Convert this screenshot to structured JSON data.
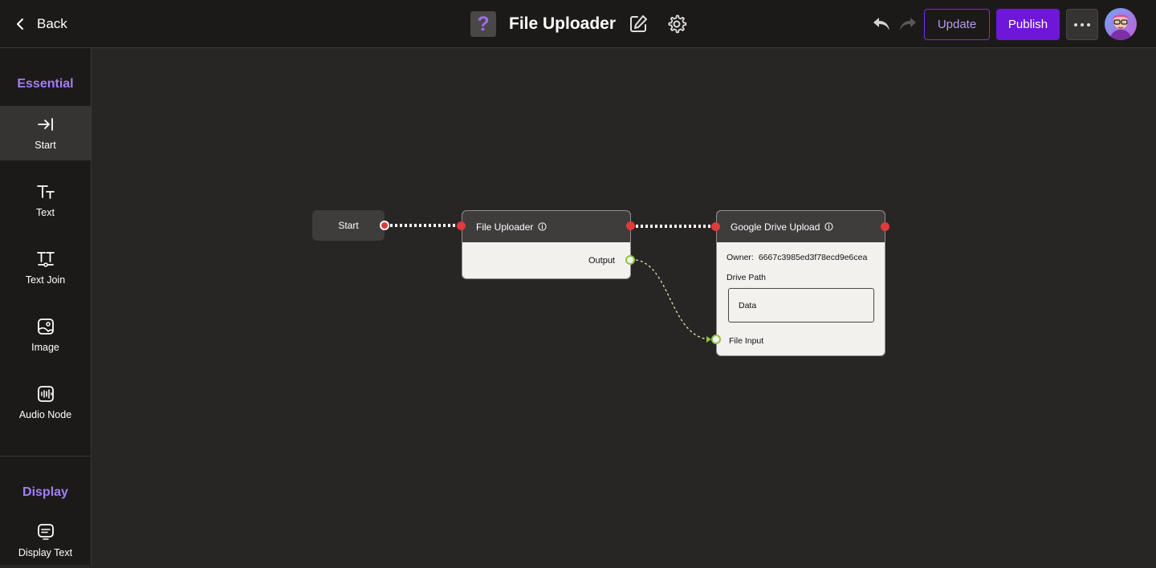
{
  "header": {
    "back_label": "Back",
    "app_icon_glyph": "?",
    "title": "File Uploader",
    "update_label": "Update",
    "publish_label": "Publish",
    "accent_color": "#6e17d9"
  },
  "sidebar": {
    "essential_label": "Essential",
    "display_label": "Display",
    "items": [
      {
        "label": "Start",
        "icon": "arrow-to-bar-icon",
        "active": true
      },
      {
        "label": "Text",
        "icon": "text-icon"
      },
      {
        "label": "Text Join",
        "icon": "text-join-icon"
      },
      {
        "label": "Image",
        "icon": "image-icon"
      },
      {
        "label": "Audio Node",
        "icon": "audio-icon"
      }
    ],
    "display_items": [
      {
        "label": "Display Text",
        "icon": "display-text-icon"
      }
    ]
  },
  "canvas": {
    "start_node": {
      "label": "Start"
    },
    "file_uploader_node": {
      "title": "File Uploader",
      "output_label": "Output"
    },
    "gdrive_node": {
      "title": "Google Drive Upload",
      "owner_label": "Owner:",
      "owner_value": "6667c3985ed3f78ecd9e6cea",
      "drive_path_label": "Drive Path",
      "drive_path_value": "Data",
      "file_input_label": "File Input"
    }
  }
}
